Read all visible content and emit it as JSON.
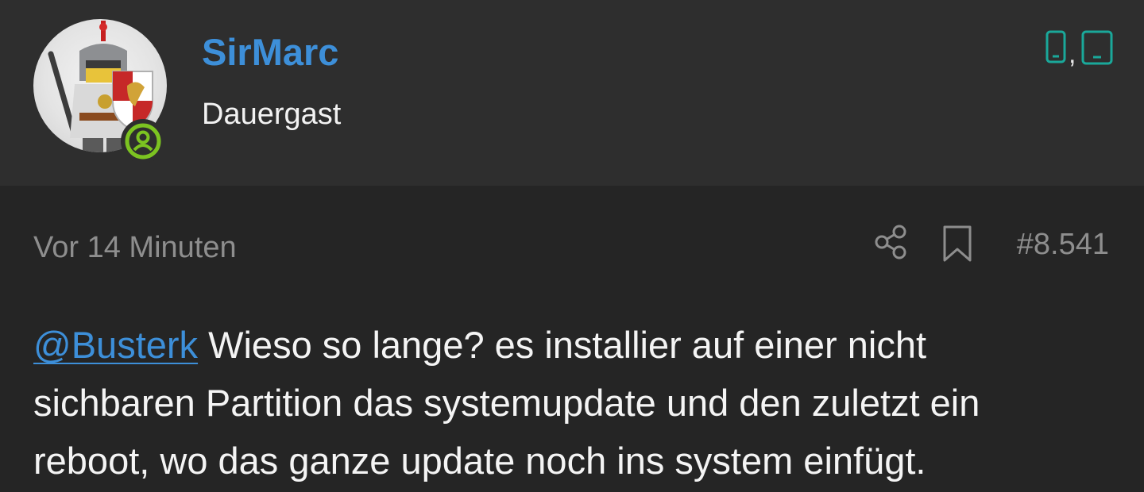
{
  "post": {
    "author": {
      "username": "SirMarc",
      "title": "Dauergast",
      "avatar_icon": "knight-avatar",
      "status_icon": "online-user-icon",
      "status_color": "#7cc321"
    },
    "devices": {
      "items": [
        "phone-icon",
        "tablet-icon"
      ],
      "separator": ",",
      "color": "#1aa89a"
    },
    "meta": {
      "time": "Vor 14 Minuten",
      "share_icon": "share-icon",
      "bookmark_icon": "bookmark-icon",
      "post_number": "#8.541"
    },
    "body": {
      "mention": "@Busterk",
      "lines": [
        " Wieso so lange? es installier auf einer nicht",
        "sichbaren Partition das systemupdate und den zuletzt ein",
        "reboot, wo das ganze update noch ins system einfügt."
      ]
    }
  },
  "colors": {
    "header_bg": "#2e2e2e",
    "body_bg": "#252525",
    "link": "#3d8fd9",
    "muted_text": "#8e8e8e",
    "text": "#f4f4f4"
  }
}
